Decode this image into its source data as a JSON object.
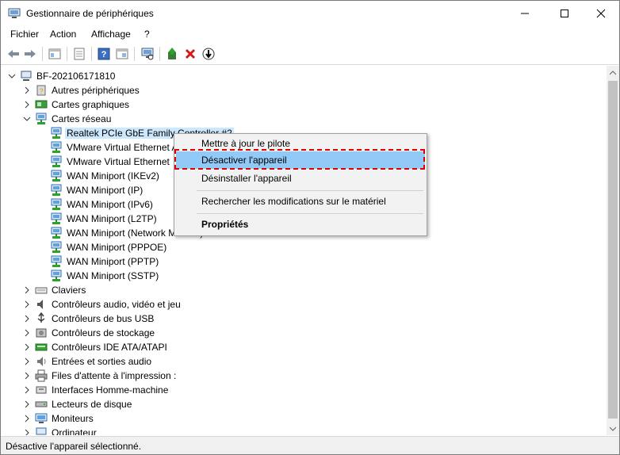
{
  "window": {
    "title": "Gestionnaire de périphériques"
  },
  "menu": [
    "Fichier",
    "Action",
    "Affichage",
    "?"
  ],
  "tree": {
    "root": "BF-202106171810",
    "categories_before": [
      {
        "label": "Autres périphériques",
        "icon": "unknown-device-icon",
        "expanded": false
      },
      {
        "label": "Cartes graphiques",
        "icon": "display-adapter-icon",
        "expanded": false
      },
      {
        "label": "Cartes réseau",
        "icon": "network-adapter-icon",
        "expanded": true
      }
    ],
    "network_adapters": [
      "Realtek PCIe GbE Family Controller #2",
      "VMware Virtual Ethernet A",
      "VMware Virtual Ethernet",
      "WAN Miniport (IKEv2)",
      "WAN Miniport (IP)",
      "WAN Miniport (IPv6)",
      "WAN Miniport (L2TP)",
      "WAN Miniport (Network Monitor)",
      "WAN Miniport (PPPOE)",
      "WAN Miniport (PPTP)",
      "WAN Miniport (SSTP)"
    ],
    "categories_after": [
      {
        "label": "Claviers",
        "icon": "keyboard-icon"
      },
      {
        "label": "Contrôleurs audio, vidéo et jeu",
        "icon": "speaker-icon"
      },
      {
        "label": "Contrôleurs de bus USB",
        "icon": "usb-icon"
      },
      {
        "label": "Contrôleurs de stockage",
        "icon": "storage-controller-icon"
      },
      {
        "label": "Contrôleurs IDE ATA/ATAPI",
        "icon": "ide-controller-icon"
      },
      {
        "label": "Entrées et sorties audio",
        "icon": "audio-io-icon"
      },
      {
        "label": "Files d'attente à l'impression :",
        "icon": "printer-icon"
      },
      {
        "label": "Interfaces Homme-machine",
        "icon": "hid-icon"
      },
      {
        "label": "Lecteurs de disque",
        "icon": "disk-drive-icon"
      },
      {
        "label": "Moniteurs",
        "icon": "monitor-icon"
      },
      {
        "label": "Ordinateur",
        "icon": "computer-icon"
      }
    ]
  },
  "context_menu": {
    "update": "Mettre à jour le pilote",
    "disable": "Désactiver l'appareil",
    "uninstall": "Désinstaller l'appareil",
    "scan": "Rechercher les modifications sur le matériel",
    "properties": "Propriétés"
  },
  "status": "Désactive l'appareil sélectionné.",
  "colors": {
    "selection": "#cce8ff",
    "menu_highlight": "#91c9f7",
    "annotation": "#e00000",
    "accent": "#2f6db5"
  }
}
